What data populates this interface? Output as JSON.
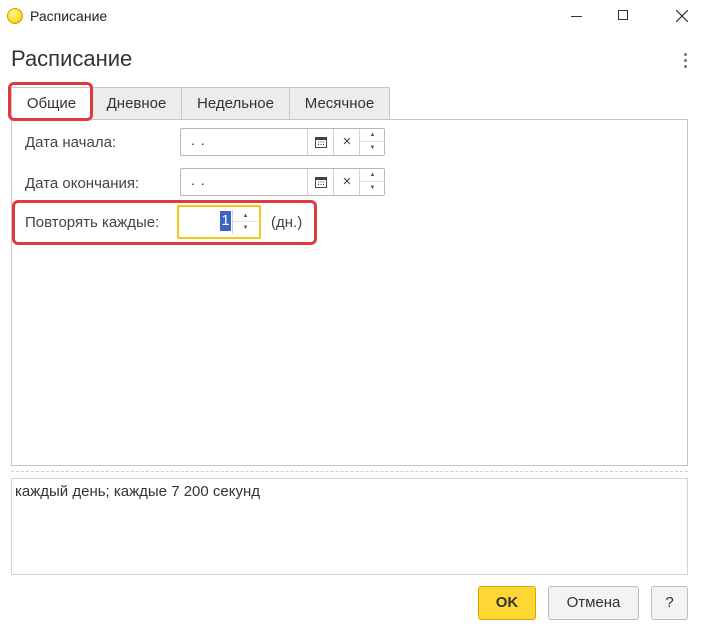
{
  "window": {
    "title": "Расписание"
  },
  "form": {
    "title": "Расписание"
  },
  "tabs": [
    {
      "label": "Общие"
    },
    {
      "label": "Дневное"
    },
    {
      "label": "Недельное"
    },
    {
      "label": "Месячное"
    }
  ],
  "general": {
    "start_label": "Дата начала:",
    "start_value": " .  .",
    "end_label": "Дата окончания:",
    "end_value": " .  .",
    "repeat_label": "Повторять каждые:",
    "repeat_value": "1",
    "repeat_unit": "(дн.)",
    "clear_symbol": "×"
  },
  "summary": {
    "text": "каждый день; каждые 7 200 секунд"
  },
  "buttons": {
    "ok": "OK",
    "cancel": "Отмена",
    "help": "?"
  },
  "colors": {
    "accent": "#fdd835",
    "highlight": "#e03a3e",
    "selection": "#3c63c7"
  }
}
